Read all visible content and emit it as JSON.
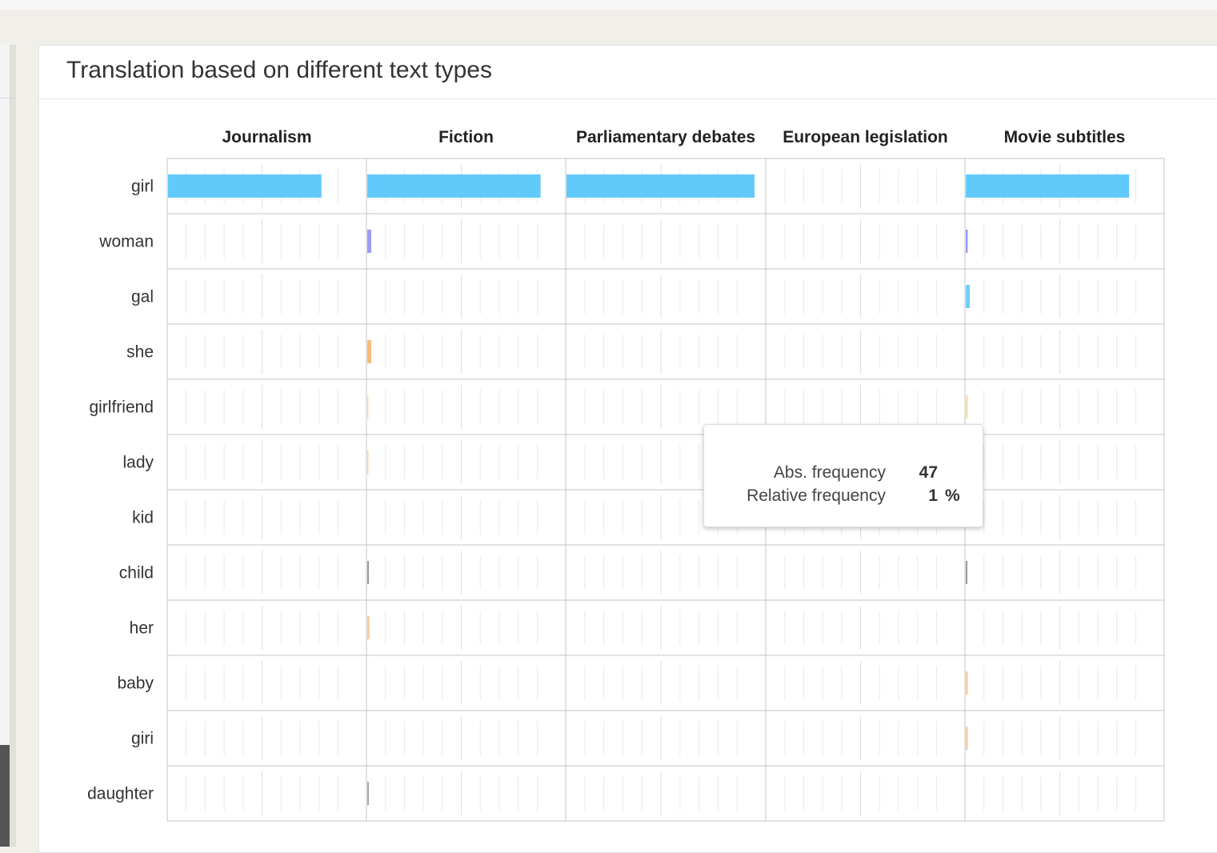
{
  "card": {
    "title": "Translation based on different text types"
  },
  "tooltip": {
    "abs_label": "Abs. frequency",
    "abs_value": "47",
    "rel_label": "Relative frequency",
    "rel_value": "1",
    "rel_unit": "%"
  },
  "chart_data": {
    "type": "bar",
    "title": "Translation based on different text types",
    "columns": [
      "Journalism",
      "Fiction",
      "Parliamentary debates",
      "European legislation",
      "Movie subtitles"
    ],
    "rows": [
      "girl",
      "woman",
      "gal",
      "she",
      "girlfriend",
      "lady",
      "kid",
      "child",
      "her",
      "baby",
      "giri",
      "daughter"
    ],
    "unit": "%",
    "xlim": [
      0,
      100
    ],
    "series": [
      {
        "name": "Journalism",
        "values": [
          77,
          0,
          0,
          0,
          0,
          0,
          0,
          0,
          0,
          0,
          0,
          0
        ],
        "colors": [
          "#62c9fb",
          "#9a9cf2",
          "#72cef8",
          "#f7b97a",
          "#fadcb0",
          "#f5d5b0",
          "#d8d8d8",
          "#9a9a9a",
          "#f5c79a",
          "#f7c89c",
          "#f6c9a1",
          "#a8a8a8"
        ]
      },
      {
        "name": "Fiction",
        "values": [
          87,
          2,
          0,
          2,
          0.4,
          0.3,
          0,
          0.8,
          1,
          0,
          0,
          0.8
        ],
        "colors": [
          "#62c9fb",
          "#9a9cf2",
          "#72cef8",
          "#f7b97a",
          "#fadcb0",
          "#f5d5b0",
          "#d8d8d8",
          "#9a9a9a",
          "#f5c79a",
          "#f7c89c",
          "#f6c9a1",
          "#a8a8a8"
        ]
      },
      {
        "name": "Parliamentary debates",
        "values": [
          94,
          0,
          0,
          0,
          0,
          0,
          0,
          0,
          0,
          0,
          0,
          0
        ],
        "colors": [
          "#62c9fb",
          "#9a9cf2",
          "#72cef8",
          "#f7b97a",
          "#fadcb0",
          "#f5d5b0",
          "#d8d8d8",
          "#9a9a9a",
          "#f5c79a",
          "#f7c89c",
          "#f6c9a1",
          "#a8a8a8"
        ]
      },
      {
        "name": "European legislation",
        "values": [
          0,
          0,
          0,
          0,
          0,
          0,
          0,
          0,
          0,
          0,
          0,
          0
        ],
        "colors": [
          "#62c9fb",
          "#9a9cf2",
          "#72cef8",
          "#f7b97a",
          "#fadcb0",
          "#f5d5b0",
          "#d8d8d8",
          "#9a9a9a",
          "#f5c79a",
          "#f7c89c",
          "#f6c9a1",
          "#a8a8a8"
        ]
      },
      {
        "name": "Movie subtitles",
        "values": [
          82,
          1,
          2,
          0,
          1,
          0,
          0,
          0.8,
          0,
          1,
          1,
          0
        ],
        "colors": [
          "#62c9fb",
          "#9a9cf2",
          "#72cef8",
          "#f7b97a",
          "#fadcb0",
          "#f5d5b0",
          "#d8d8d8",
          "#9a9a9a",
          "#f5c79a",
          "#f7c89c",
          "#f6c9a1",
          "#a8a8a8"
        ]
      }
    ],
    "grid": true,
    "legend": "none"
  }
}
